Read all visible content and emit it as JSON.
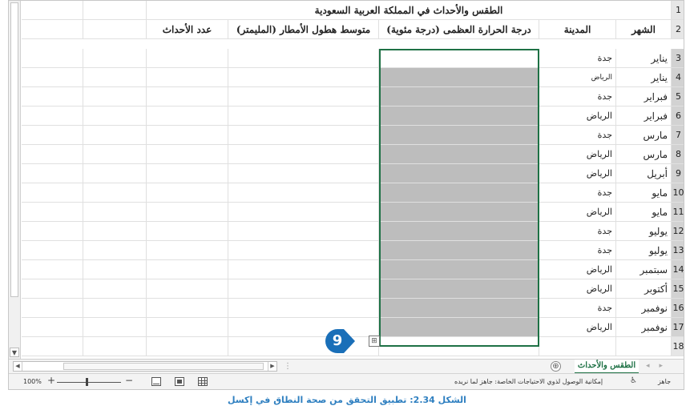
{
  "sheet": {
    "title": "الطقس والأحداث في المملكة العربية السعودية",
    "headers": {
      "month": "الشهر",
      "city": "المدينة",
      "temp": "درجة الحرارة العظمى (درجة مئوية)",
      "rain": "متوسط هطول الأمطار (المليمتر)",
      "events": "عدد الأحداث"
    },
    "row_numbers": [
      "1",
      "2",
      "3",
      "4",
      "5",
      "6",
      "7",
      "8",
      "9",
      "10",
      "11",
      "12",
      "13",
      "14",
      "15",
      "16",
      "17",
      "18"
    ],
    "rows": [
      {
        "month": "يناير",
        "city": "جدة"
      },
      {
        "month": "يناير",
        "city": "الرياض"
      },
      {
        "month": "فبراير",
        "city": "جدة"
      },
      {
        "month": "فبراير",
        "city": "الرياض"
      },
      {
        "month": "مارس",
        "city": "جدة"
      },
      {
        "month": "مارس",
        "city": "الرياض"
      },
      {
        "month": "أبريل",
        "city": "الرياض"
      },
      {
        "month": "مايو",
        "city": "جدة"
      },
      {
        "month": "مايو",
        "city": "الرياض"
      },
      {
        "month": "يوليو",
        "city": "جدة"
      },
      {
        "month": "يوليو",
        "city": "جدة"
      },
      {
        "month": "سبتمبر",
        "city": "الرياض"
      },
      {
        "month": "أكتوبر",
        "city": "الرياض"
      },
      {
        "month": "نوفمبر",
        "city": "جدة"
      },
      {
        "month": "نوفمبر",
        "city": "الرياض"
      }
    ]
  },
  "callout": {
    "number": "9",
    "color": "#1a6fb8"
  },
  "tabs": {
    "sheet_name": "الطقس والأحداث",
    "add_symbol": "⊕",
    "nav_prev": "◂",
    "nav_next": "▸",
    "separator": "⋮"
  },
  "status": {
    "zoom": "100%",
    "minus": "−",
    "plus": "+",
    "accessibility": "إمكانية الوصول لذوي الاحتياجات الخاصة: جاهز لما نريده",
    "ready": "جاهز"
  },
  "caption": "الشكل 2.34: تطبيق التحقق من صحة النطاق في إكسل",
  "colors": {
    "selection_border": "#1e7145",
    "shaded": "#bdbdbd",
    "caption": "#2e7fc0",
    "header_bg": "#e6e6e6"
  }
}
